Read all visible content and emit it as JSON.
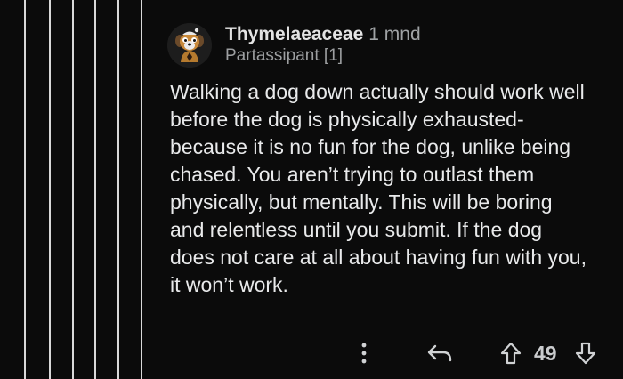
{
  "comment": {
    "username": "Thymelaeaceae",
    "age": "1 mnd",
    "flair": "Partassipant [1]",
    "body": "Walking a dog down actually should work well before the dog is physically exhausted- because it is no fun for the dog, unlike being chased. You aren’t trying to outlast them physically, but mentally. This will be boring and relentless until you submit. If the dog does not care at all about having fun with you, it won’t work."
  },
  "actions": {
    "score": "49"
  },
  "icons": {
    "avatar": "dog-avatar-icon",
    "more": "more-vertical-icon",
    "reply": "reply-arrow-icon",
    "upvote": "upvote-arrow-icon",
    "downvote": "downvote-arrow-icon"
  },
  "colors": {
    "background": "#0b0b0b",
    "thread_line": "#d9d9d9",
    "text": "#e9eaeb",
    "muted": "#a0a3a5"
  }
}
